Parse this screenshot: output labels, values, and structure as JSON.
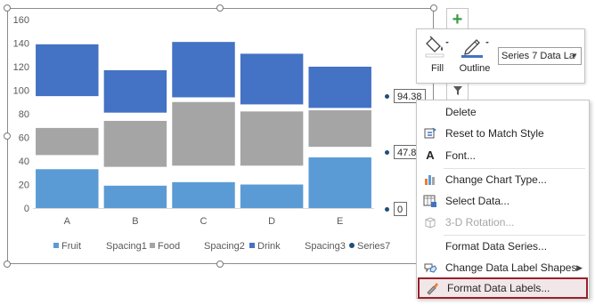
{
  "chart_data": {
    "type": "bar",
    "stacked": true,
    "categories": [
      "A",
      "B",
      "C",
      "D",
      "E"
    ],
    "ylim": [
      0,
      160
    ],
    "yticks": [
      0,
      20,
      40,
      60,
      80,
      100,
      120,
      140,
      160
    ],
    "series": [
      {
        "name": "Fruit",
        "color": "#5b9bd5",
        "values": [
          33,
          19,
          22,
          20,
          43
        ]
      },
      {
        "name": "Spacing1",
        "color": "transparent",
        "values": [
          12,
          16,
          14,
          16,
          9
        ]
      },
      {
        "name": "Food",
        "color": "#a5a5a5",
        "values": [
          23,
          39,
          54,
          46,
          31
        ]
      },
      {
        "name": "Spacing2",
        "color": "transparent",
        "values": [
          27,
          7,
          4,
          6,
          2
        ]
      },
      {
        "name": "Drink",
        "color": "#4472c4",
        "values": [
          44,
          36,
          47,
          43,
          35
        ]
      },
      {
        "name": "Spacing3",
        "color": "transparent",
        "values": [
          0,
          0,
          0,
          0,
          0
        ]
      },
      {
        "name": "Series7",
        "color": "#1f4e79",
        "values": [
          null,
          null,
          null,
          null,
          null
        ]
      }
    ],
    "legend": [
      "Fruit",
      "Spacing1",
      "Food",
      "Spacing2",
      "Drink",
      "Spacing3",
      "Series7"
    ],
    "legend_position": "bottom",
    "grid": false
  },
  "data_labels": [
    "94.38",
    "47.8",
    "0"
  ],
  "toolbar": {
    "fill_label": "Fill",
    "outline_label": "Outline",
    "series_select_value": "Series 7 Data La"
  },
  "context_menu": {
    "items": [
      {
        "label": "Delete",
        "icon": "none",
        "enabled": true
      },
      {
        "label": "Reset to Match Style",
        "icon": "reset-style-icon",
        "enabled": true
      },
      {
        "label": "Font...",
        "icon": "font-icon",
        "enabled": true
      },
      {
        "label": "Change Chart Type...",
        "icon": "chart-type-icon",
        "enabled": true
      },
      {
        "label": "Select Data...",
        "icon": "select-data-icon",
        "enabled": true
      },
      {
        "label": "3-D Rotation...",
        "icon": "3d-rotation-icon",
        "enabled": false
      },
      {
        "label": "Format Data Series...",
        "icon": "none",
        "enabled": true
      },
      {
        "label": "Change Data Label Shapes",
        "icon": "label-shapes-icon",
        "enabled": true
      },
      {
        "label": "Format Data Labels...",
        "icon": "format-labels-icon",
        "enabled": true
      }
    ]
  }
}
